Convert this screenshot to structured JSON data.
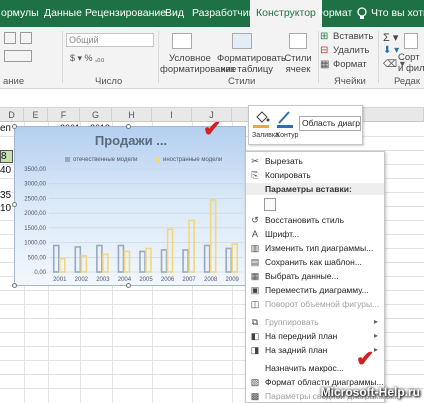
{
  "tabs": [
    "ормулы",
    "Данные",
    "Рецензирование",
    "Вид",
    "Разработчик",
    "Конструктор",
    "Формат",
    "Что вы хотите"
  ],
  "tell_me_icon": "lightbulb-icon",
  "ribbon": {
    "number_format": "Общий",
    "cond_format": [
      "Условное",
      "форматирование"
    ],
    "format_table": [
      "Форматировать",
      "как таблицу"
    ],
    "cell_styles": [
      "Стили",
      "ячеек"
    ],
    "insert": "Вставить",
    "delete": "Удалить",
    "format": "Формат",
    "sort": [
      "Сорт",
      "и фил"
    ],
    "group_labels": [
      "ание",
      "Число",
      "Стили",
      "Ячейки",
      "Редак"
    ]
  },
  "sheet": {
    "columns": [
      "E",
      "F",
      "G",
      "H",
      "I",
      "J",
      "K"
    ],
    "partial_cells": [
      "еп",
      "2001",
      "2018"
    ],
    "left_values": [
      "8",
      "40",
      "35",
      "10"
    ],
    "left_letter": "D"
  },
  "chart": {
    "title": "Продажи ...",
    "legend": [
      "отечественные модели",
      "иностранные модели"
    ],
    "series_colors": [
      "#9aa8be",
      "#f3d77a"
    ]
  },
  "chart_data": {
    "type": "bar",
    "title": "Продажи ...",
    "categories": [
      "2001",
      "2002",
      "2003",
      "2004",
      "2005",
      "2006",
      "2007",
      "2008",
      "2009"
    ],
    "series": [
      {
        "name": "отечественные модели",
        "values": [
          900,
          850,
          900,
          900,
          700,
          750,
          750,
          900,
          800
        ]
      },
      {
        "name": "иностранные модели",
        "values": [
          450,
          550,
          600,
          700,
          800,
          1450,
          1750,
          2450,
          950
        ]
      }
    ],
    "ylim": [
      0,
      3500
    ],
    "yticks": [
      "0,00",
      "500,00",
      "1000,00",
      "1500,00",
      "2000,00",
      "2500,00",
      "3000,00",
      "3500,00"
    ]
  },
  "mini_toolbar": {
    "fill": "Заливка",
    "outline": "Контур",
    "dropdown": "Область диагр..."
  },
  "context_menu": {
    "cut": "Вырезать",
    "copy": "Копировать",
    "paste_header": "Параметры вставки:",
    "reset_style": "Восстановить стиль",
    "font": "Шрифт...",
    "change_type": "Изменить тип диаграммы...",
    "save_template": "Сохранить как шаблон...",
    "select_data": "Выбрать данные...",
    "move_chart": "Переместить диаграмму...",
    "rotate3d": "Поворот объемной фигуры...",
    "group": "Группировать",
    "bring_front": "На передний план",
    "send_back": "На задний план",
    "assign_macro": "Назначить макрос...",
    "format_area": "Формат области диаграммы...",
    "pivot_params": "Параметры сводной диаграммы..."
  },
  "watermark": "Microsoft-Help.ru"
}
